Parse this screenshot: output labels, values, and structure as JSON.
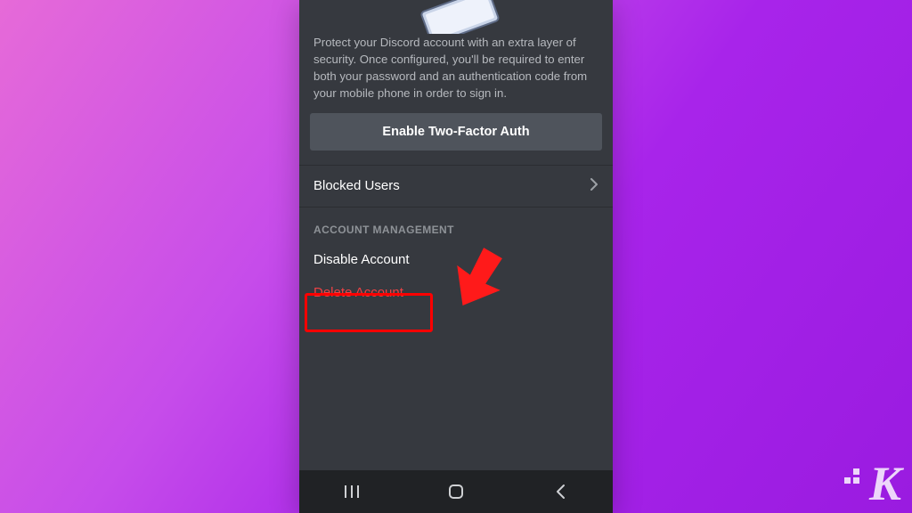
{
  "twofa": {
    "description": "Protect your Discord account with an extra layer of security. Once configured, you'll be required to enter both your password and an authentication code from your mobile phone in order to sign in.",
    "enable_button": "Enable Two-Factor Auth"
  },
  "rows": {
    "blocked_users": "Blocked Users"
  },
  "section": {
    "account_management": "ACCOUNT MANAGEMENT"
  },
  "actions": {
    "disable_account": "Disable Account",
    "delete_account": "Delete Account"
  },
  "watermark": {
    "letter": "K"
  },
  "colors": {
    "panel_bg": "#36393f",
    "button_bg": "#4f545c",
    "danger": "#ed4245",
    "highlight": "#ff0000"
  }
}
